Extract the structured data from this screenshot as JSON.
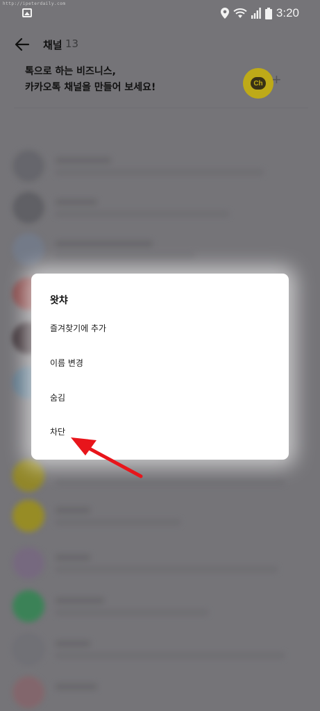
{
  "status_bar": {
    "watermark": "http://ipeterdaily.com",
    "time": "3:20",
    "icons": [
      "gallery-icon",
      "location-icon",
      "wifi-icon",
      "signal-icon",
      "battery-icon"
    ]
  },
  "app_bar": {
    "title": "채널",
    "count": "13",
    "back_icon": "back-arrow-icon"
  },
  "banner": {
    "line1": "톡으로 하는 비즈니스,",
    "line2": "카카오톡 채널을 만들어 보세요!",
    "badge_label": "Ch",
    "add_symbol": "+"
  },
  "dialog": {
    "title": "왓챠",
    "items": [
      "즐겨찾기에 추가",
      "이름 변경",
      "숨김",
      "차단"
    ]
  },
  "colors": {
    "background_dim": "#7c7b7f",
    "dialog_bg": "#ffffff",
    "arrow": "#e8151b",
    "channel_yellow": "#c9b41a"
  }
}
